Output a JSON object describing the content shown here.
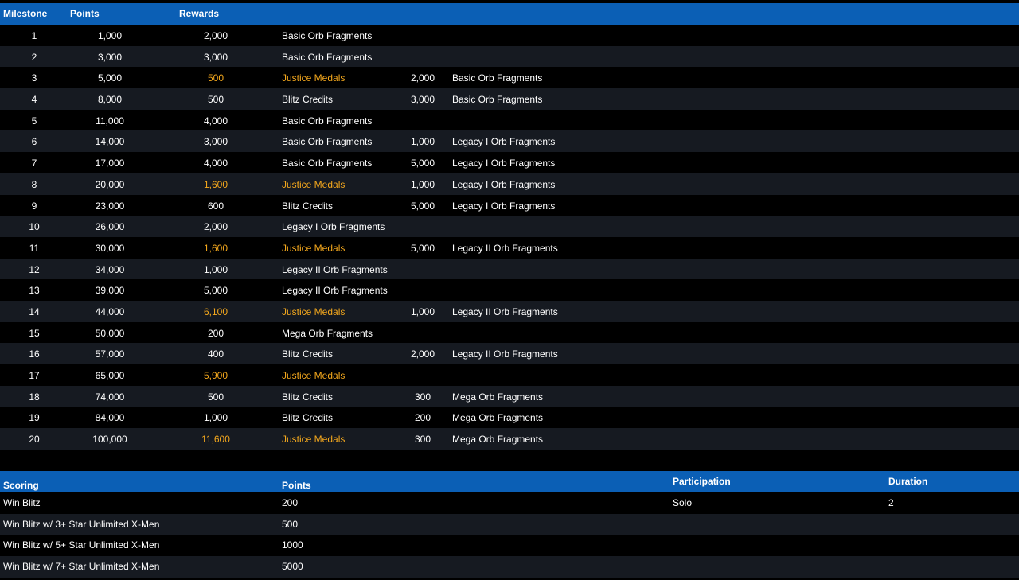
{
  "milestones_table": {
    "headers": {
      "milestone": "Milestone",
      "points": "Points",
      "rewards": "Rewards"
    },
    "highlight_color": "#f4a81d",
    "header_color": "#0b5fb5",
    "rows": [
      {
        "milestone": "1",
        "points": "1,000",
        "r1_value": "2,000",
        "r1_name": "Basic Orb Fragments",
        "r2_value": "",
        "r2_name": "",
        "highlight": false
      },
      {
        "milestone": "2",
        "points": "3,000",
        "r1_value": "3,000",
        "r1_name": "Basic Orb Fragments",
        "r2_value": "",
        "r2_name": "",
        "highlight": false
      },
      {
        "milestone": "3",
        "points": "5,000",
        "r1_value": "500",
        "r1_name": "Justice Medals",
        "r2_value": "2,000",
        "r2_name": "Basic Orb Fragments",
        "highlight": true
      },
      {
        "milestone": "4",
        "points": "8,000",
        "r1_value": "500",
        "r1_name": "Blitz Credits",
        "r2_value": "3,000",
        "r2_name": "Basic Orb Fragments",
        "highlight": false
      },
      {
        "milestone": "5",
        "points": "11,000",
        "r1_value": "4,000",
        "r1_name": "Basic Orb Fragments",
        "r2_value": "",
        "r2_name": "",
        "highlight": false
      },
      {
        "milestone": "6",
        "points": "14,000",
        "r1_value": "3,000",
        "r1_name": "Basic Orb Fragments",
        "r2_value": "1,000",
        "r2_name": "Legacy I Orb Fragments",
        "highlight": false
      },
      {
        "milestone": "7",
        "points": "17,000",
        "r1_value": "4,000",
        "r1_name": "Basic Orb Fragments",
        "r2_value": "5,000",
        "r2_name": "Legacy I Orb Fragments",
        "highlight": false
      },
      {
        "milestone": "8",
        "points": "20,000",
        "r1_value": "1,600",
        "r1_name": "Justice Medals",
        "r2_value": "1,000",
        "r2_name": "Legacy I Orb Fragments",
        "highlight": true
      },
      {
        "milestone": "9",
        "points": "23,000",
        "r1_value": "600",
        "r1_name": "Blitz Credits",
        "r2_value": "5,000",
        "r2_name": "Legacy I Orb Fragments",
        "highlight": false
      },
      {
        "milestone": "10",
        "points": "26,000",
        "r1_value": "2,000",
        "r1_name": "Legacy I Orb Fragments",
        "r2_value": "",
        "r2_name": "",
        "highlight": false
      },
      {
        "milestone": "11",
        "points": "30,000",
        "r1_value": "1,600",
        "r1_name": "Justice Medals",
        "r2_value": "5,000",
        "r2_name": "Legacy II Orb Fragments",
        "highlight": true
      },
      {
        "milestone": "12",
        "points": "34,000",
        "r1_value": "1,000",
        "r1_name": "Legacy II Orb Fragments",
        "r2_value": "",
        "r2_name": "",
        "highlight": false
      },
      {
        "milestone": "13",
        "points": "39,000",
        "r1_value": "5,000",
        "r1_name": "Legacy II Orb Fragments",
        "r2_value": "",
        "r2_name": "",
        "highlight": false
      },
      {
        "milestone": "14",
        "points": "44,000",
        "r1_value": "6,100",
        "r1_name": "Justice Medals",
        "r2_value": "1,000",
        "r2_name": "Legacy II Orb Fragments",
        "highlight": true
      },
      {
        "milestone": "15",
        "points": "50,000",
        "r1_value": "200",
        "r1_name": "Mega Orb Fragments",
        "r2_value": "",
        "r2_name": "",
        "highlight": false
      },
      {
        "milestone": "16",
        "points": "57,000",
        "r1_value": "400",
        "r1_name": "Blitz Credits",
        "r2_value": "2,000",
        "r2_name": "Legacy II Orb Fragments",
        "highlight": false
      },
      {
        "milestone": "17",
        "points": "65,000",
        "r1_value": "5,900",
        "r1_name": "Justice Medals",
        "r2_value": "",
        "r2_name": "",
        "highlight": true
      },
      {
        "milestone": "18",
        "points": "74,000",
        "r1_value": "500",
        "r1_name": "Blitz Credits",
        "r2_value": "300",
        "r2_name": "Mega Orb Fragments",
        "highlight": false
      },
      {
        "milestone": "19",
        "points": "84,000",
        "r1_value": "1,000",
        "r1_name": "Blitz Credits",
        "r2_value": "200",
        "r2_name": "Mega Orb Fragments",
        "highlight": false
      },
      {
        "milestone": "20",
        "points": "100,000",
        "r1_value": "11,600",
        "r1_name": "Justice Medals",
        "r2_value": "300",
        "r2_name": "Mega Orb Fragments",
        "highlight": true
      }
    ]
  },
  "scoring_table": {
    "headers": {
      "scoring": "Scoring",
      "points": "Points",
      "participation": "Participation",
      "duration": "Duration"
    },
    "rows": [
      {
        "name": "Win Blitz",
        "points": "200",
        "participation": "Solo",
        "duration": "2"
      },
      {
        "name": "Win Blitz w/ 3+ Star Unlimited X-Men",
        "points": "500",
        "participation": "",
        "duration": ""
      },
      {
        "name": "Win Blitz w/ 5+ Star Unlimited X-Men",
        "points": "1000",
        "participation": "",
        "duration": ""
      },
      {
        "name": "Win Blitz w/ 7+ Star Unlimited X-Men",
        "points": "5000",
        "participation": "",
        "duration": ""
      }
    ]
  }
}
